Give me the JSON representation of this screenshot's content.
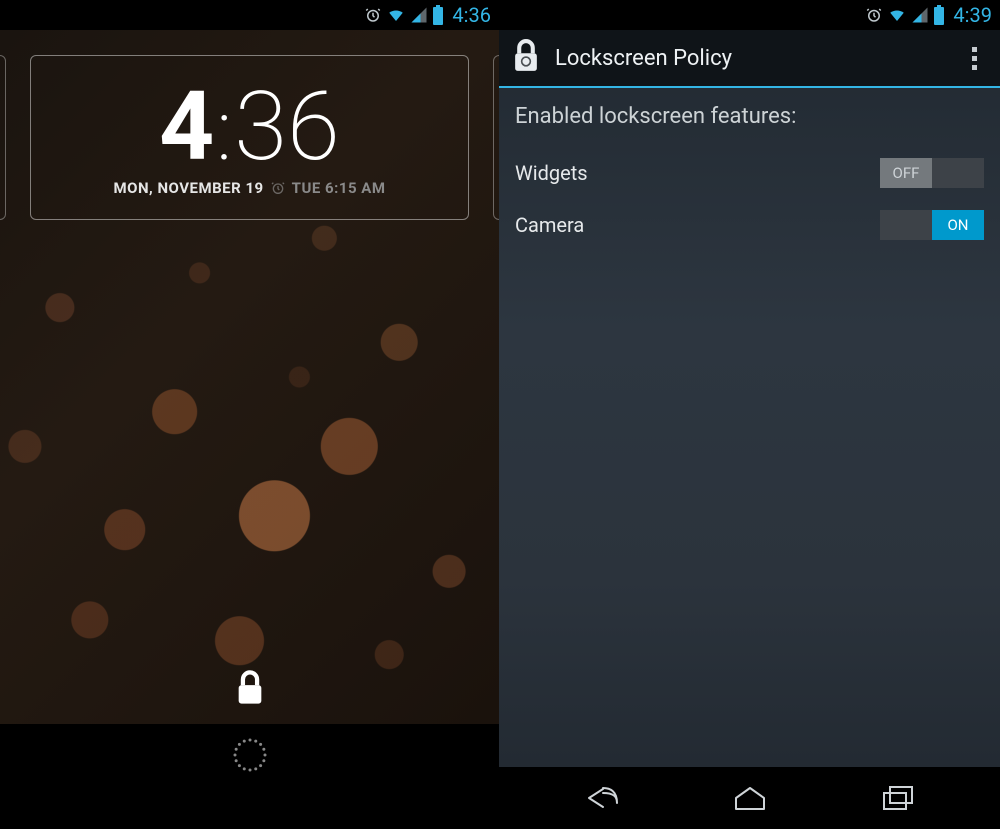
{
  "colors": {
    "accent": "#33b5e5"
  },
  "left": {
    "status": {
      "time": "4:36"
    },
    "clock": {
      "hour": "4",
      "minute": "36"
    },
    "date": "MON, NOVEMBER 19",
    "alarm": "TUE 6:15 AM"
  },
  "right": {
    "status": {
      "time": "4:39"
    },
    "app_title": "Lockscreen Policy",
    "section": "Enabled lockscreen features:",
    "prefs": {
      "widgets": {
        "label": "Widgets",
        "value": "OFF",
        "on": false
      },
      "camera": {
        "label": "Camera",
        "value": "ON",
        "on": true
      }
    }
  },
  "icons": {
    "alarm": "alarm-icon",
    "wifi": "wifi-icon",
    "signal": "signal-icon",
    "battery": "battery-icon",
    "lock": "lock-icon",
    "back": "back-icon",
    "home": "home-icon",
    "recents": "recents-icon",
    "overflow": "overflow-icon",
    "applock": "app-lock-icon"
  }
}
